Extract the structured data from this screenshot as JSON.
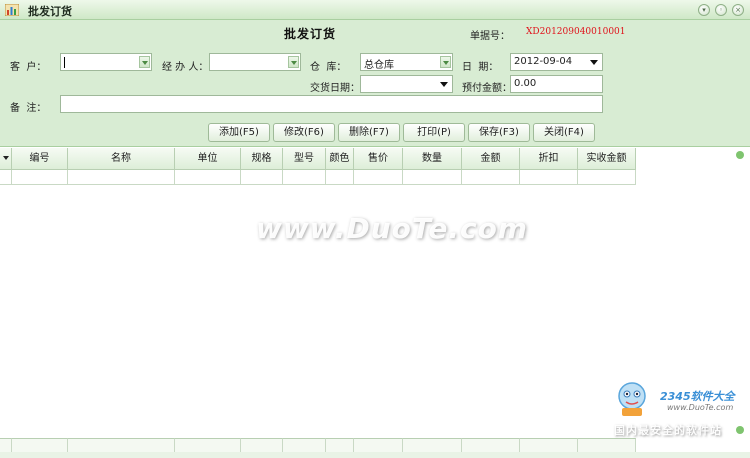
{
  "window": {
    "title": "批发订货"
  },
  "header": {
    "main_title": "批发订货",
    "doc_no_label": "单据号：",
    "doc_no_value": "XD201209040010001"
  },
  "form": {
    "customer_label": "客  户：",
    "customer_value": "",
    "handler_label": "经 办 人：",
    "handler_value": "",
    "warehouse_label": "仓  库：",
    "warehouse_value": "总仓库",
    "date_label": "日  期：",
    "date_value": "2012-09-04",
    "delivery_date_label": "交货日期：",
    "delivery_date_value": "",
    "prepay_label": "预付金额：",
    "prepay_value": "0.00",
    "note_label": "备  注：",
    "note_value": ""
  },
  "toolbar": {
    "add_label": "添加(F5)",
    "edit_label": "修改(F6)",
    "delete_label": "删除(F7)",
    "print_label": "打印(P)",
    "save_label": "保存(F3)",
    "close_label": "关闭(F4)"
  },
  "grid": {
    "columns": [
      "编号",
      "名称",
      "单位",
      "规格",
      "型号",
      "颜色",
      "售价",
      "数量",
      "金额",
      "折扣",
      "实收金额"
    ]
  },
  "watermark": {
    "center": "www.DuoTe.com",
    "brand": "2345软件大全",
    "site": "www.DuoTe.com",
    "slogan": "国内最安全的软件站"
  },
  "colors": {
    "panel_bg": "#d8ecd3",
    "doc_no_color": "#e0141c",
    "scroll_accent": "#7fc46f"
  }
}
